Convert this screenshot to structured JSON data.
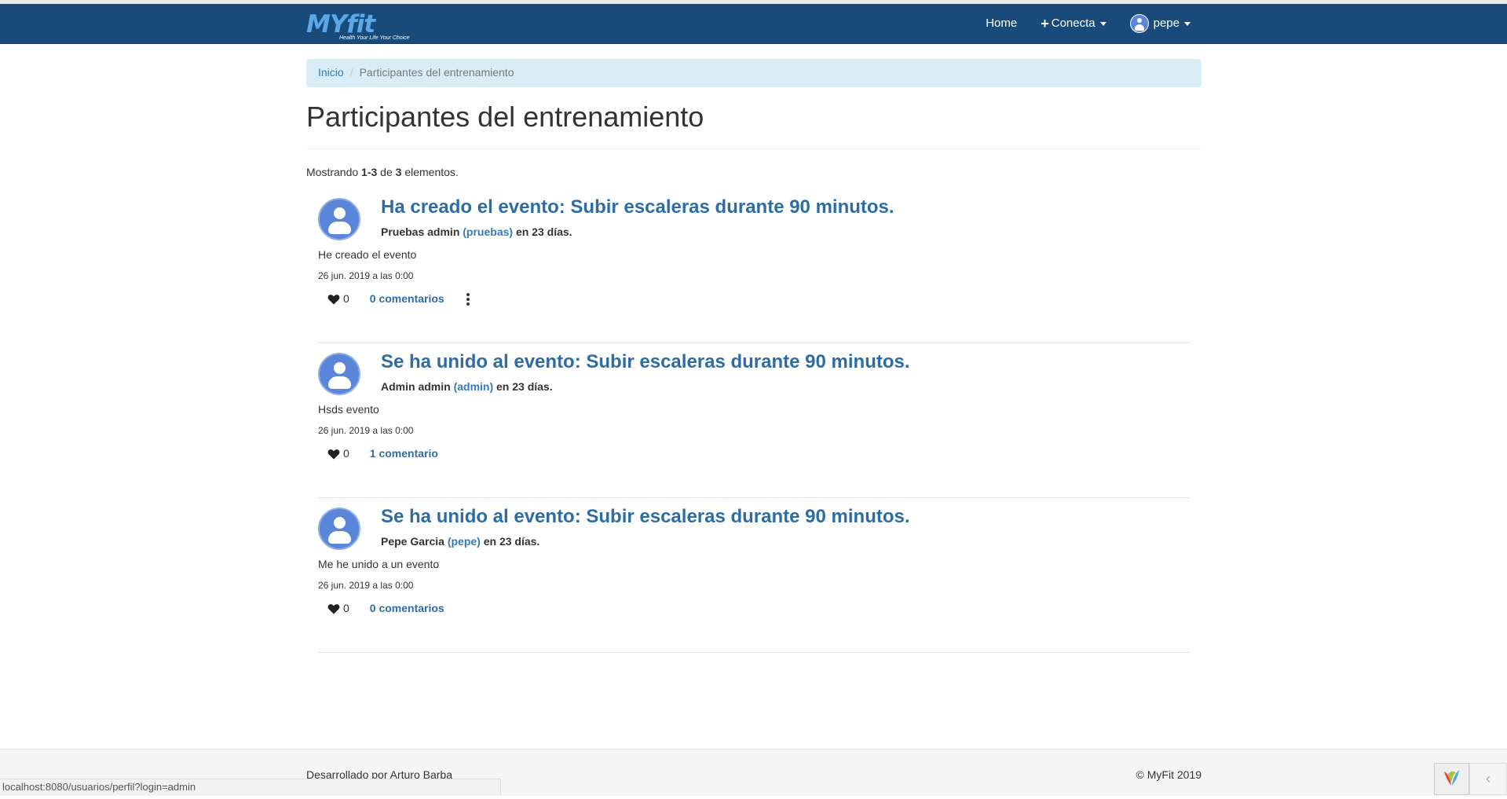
{
  "navbar": {
    "brand": "MYfit",
    "tagline": "Health Your Life Your Choice",
    "home": "Home",
    "connect": "Conecta",
    "user": "pepe"
  },
  "breadcrumb": {
    "home": "Inicio",
    "current": "Participantes del entrenamiento"
  },
  "page": {
    "title": "Participantes del entrenamiento",
    "summary": {
      "prefix": "Mostrando ",
      "range": "1-3",
      "middle": " de ",
      "total": "3",
      "suffix": " elementos."
    }
  },
  "items": [
    {
      "title": "Ha creado el evento: Subir escaleras durante 90 minutos.",
      "author": "Pruebas admin",
      "login": "(pruebas)",
      "when": "en 23 días.",
      "body": "He creado el evento",
      "date": "26 jun. 2019 a las 0:00",
      "likes": "0",
      "comments": "0 comentarios"
    },
    {
      "title": "Se ha unido al evento: Subir escaleras durante 90 minutos.",
      "author": "Admin admin",
      "login": "(admin)",
      "when": "en 23 días.",
      "body": "Hsds evento",
      "date": "26 jun. 2019 a las 0:00",
      "likes": "0",
      "comments": "1 comentario"
    },
    {
      "title": "Se ha unido al evento: Subir escaleras durante 90 minutos.",
      "author": "Pepe Garcia",
      "login": "(pepe)",
      "when": "en 23 días.",
      "body": "Me he unido a un evento",
      "date": "26 jun. 2019 a las 0:00",
      "likes": "0",
      "comments": "0 comentarios"
    }
  ],
  "footer": {
    "left": "Desarrollado por Arturo Barba",
    "right": "© MyFit 2019"
  },
  "statusbar": "localhost:8080/usuarios/perfil?login=admin",
  "colors": {
    "navbar": "#184a7a",
    "link": "#337ab7",
    "breadcrumb_bg": "#d9edf7",
    "avatar": "#5b85d8"
  }
}
